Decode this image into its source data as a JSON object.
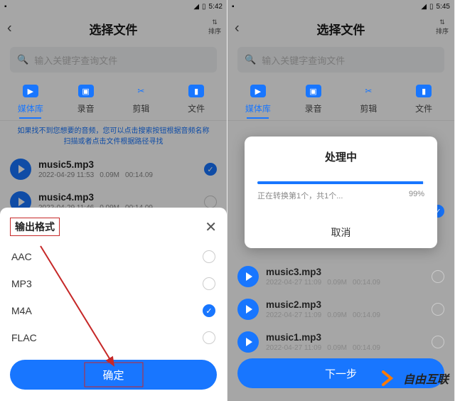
{
  "left": {
    "status": {
      "time": "5:42"
    },
    "header": {
      "title": "选择文件",
      "sort": "排序"
    },
    "search": {
      "placeholder": "输入关键字查询文件"
    },
    "tabs": [
      {
        "label": "媒体库",
        "active": true
      },
      {
        "label": "录音",
        "active": false
      },
      {
        "label": "剪辑",
        "active": false
      },
      {
        "label": "文件",
        "active": false
      }
    ],
    "hint": "如果找不到您想要的音频，您可以点击搜索按钮根据音频名称扫描或者点击文件根据路径寻找",
    "tracks": [
      {
        "title": "music5.mp3",
        "date": "2022-04-29 11:53",
        "size": "0.09M",
        "dur": "00:14.09",
        "checked": true
      },
      {
        "title": "music4.mp3",
        "date": "2022-04-29 11:46",
        "size": "0.09M",
        "dur": "00:14.09",
        "checked": false
      }
    ],
    "sheet": {
      "title": "输出格式",
      "options": [
        {
          "label": "AAC",
          "checked": false
        },
        {
          "label": "MP3",
          "checked": false
        },
        {
          "label": "M4A",
          "checked": true
        },
        {
          "label": "FLAC",
          "checked": false
        }
      ],
      "confirm": "确定"
    }
  },
  "right": {
    "status": {
      "time": "5:45"
    },
    "header": {
      "title": "选择文件",
      "sort": "排序"
    },
    "search": {
      "placeholder": "输入关键字查询文件"
    },
    "tabs": [
      {
        "label": "媒体库",
        "active": true
      },
      {
        "label": "录音",
        "active": false
      },
      {
        "label": "剪辑",
        "active": false
      },
      {
        "label": "文件",
        "active": false
      }
    ],
    "dialog": {
      "title": "处理中",
      "status_left": "正在转换第1个，共1个...",
      "status_right": "99%",
      "cancel": "取消"
    },
    "tracks": [
      {
        "title": "music3.mp3",
        "date": "2022-04-27 11:09",
        "size": "0.09M",
        "dur": "00:14.09",
        "checked": false
      },
      {
        "title": "music2.mp3",
        "date": "2022-04-27 11:09",
        "size": "0.09M",
        "dur": "00:14.09",
        "checked": false
      },
      {
        "title": "music1.mp3",
        "date": "2022-04-27 11:09",
        "size": "0.09M",
        "dur": "00:14.09",
        "checked": false
      }
    ],
    "bottom_hidden_tracks": [
      {
        "checked": true
      }
    ],
    "next_button": "下一步",
    "watermark": "自由互联"
  }
}
